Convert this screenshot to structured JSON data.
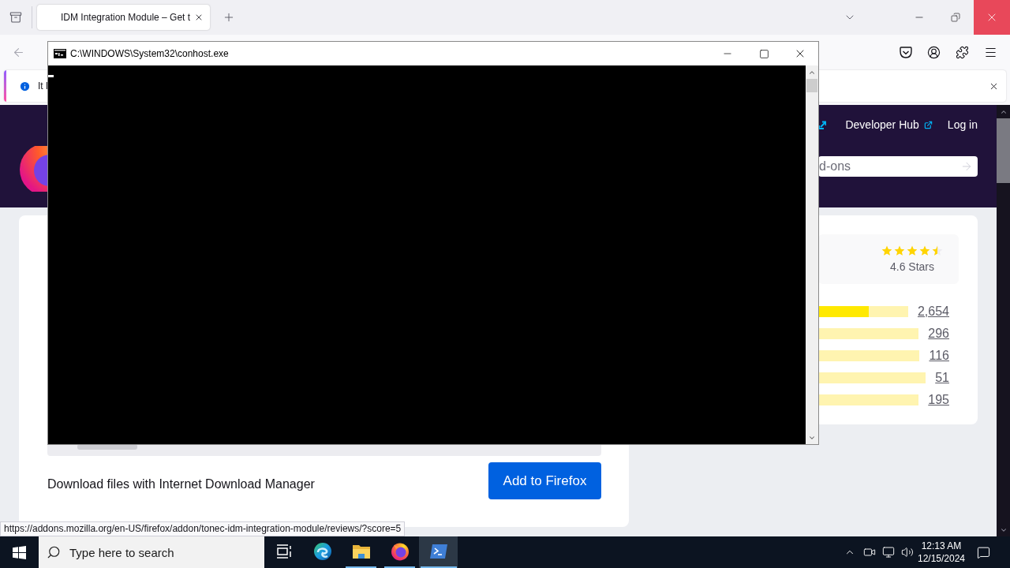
{
  "browser": {
    "tabs": [
      {
        "title": "IDM Integration Module – Get t",
        "selected": true
      }
    ],
    "notification": {
      "text": "It l"
    },
    "header": {
      "links": [
        {
          "label": "Developer Hub",
          "external": true
        },
        {
          "label": "Log in",
          "external": false
        }
      ],
      "search": {
        "placeholder": "d-ons"
      }
    },
    "rating": {
      "stars": 4.5,
      "label": "4.6 Stars"
    },
    "rating_bars": [
      {
        "level": 0.56,
        "count": "2,654"
      },
      {
        "count": "296"
      },
      {
        "count": "116"
      },
      {
        "count": "51"
      },
      {
        "count": "195"
      }
    ],
    "addon": {
      "summary": "Download files with Internet Download Manager",
      "add_button": "Add to Firefox"
    },
    "status_url": "https://addons.mozilla.org/en-US/firefox/addon/tonec-idm-integration-module/reviews/?score=5"
  },
  "console": {
    "title": "C:\\WINDOWS\\System32\\conhost.exe"
  },
  "taskbar": {
    "search": {
      "placeholder": "Type here to search"
    },
    "apps": [
      {
        "kind": "task-view",
        "running": false,
        "selected": false
      },
      {
        "kind": "edge",
        "running": false,
        "selected": false
      },
      {
        "kind": "explorer",
        "running": true,
        "selected": false
      },
      {
        "kind": "firefox",
        "running": true,
        "selected": false
      },
      {
        "kind": "terminal",
        "running": true,
        "selected": true
      }
    ],
    "clock": {
      "time": "12:13 AM",
      "date": "12/15/2024"
    }
  }
}
